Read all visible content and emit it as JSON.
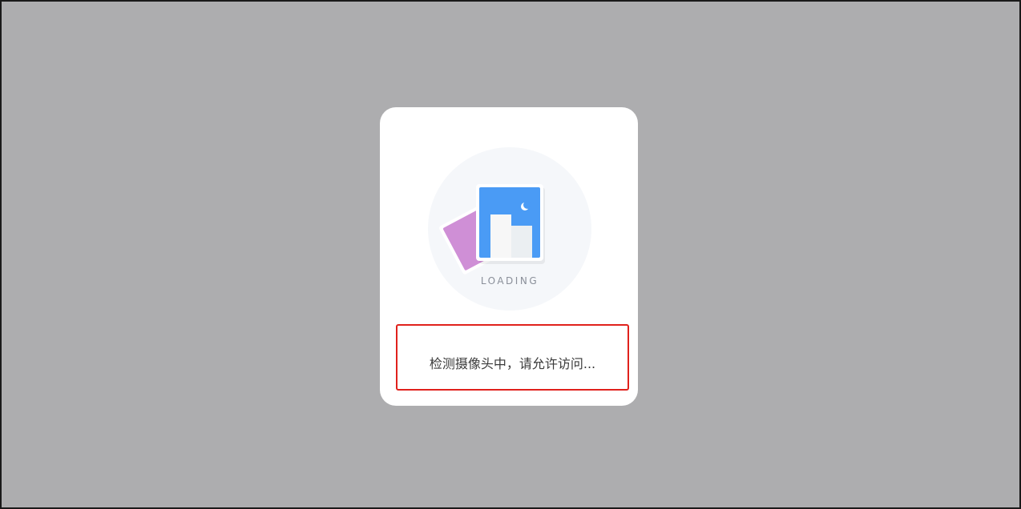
{
  "loader": {
    "label": "LOADING",
    "icon": "photo-cards-icon"
  },
  "status": {
    "message": "检测摄像头中，请允许访问..."
  },
  "colors": {
    "backdrop": "#adadaf",
    "modal": "#ffffff",
    "highlight_border": "#e0211c",
    "card_back": "#cf8fd6",
    "card_front": "#4a9bf5"
  }
}
